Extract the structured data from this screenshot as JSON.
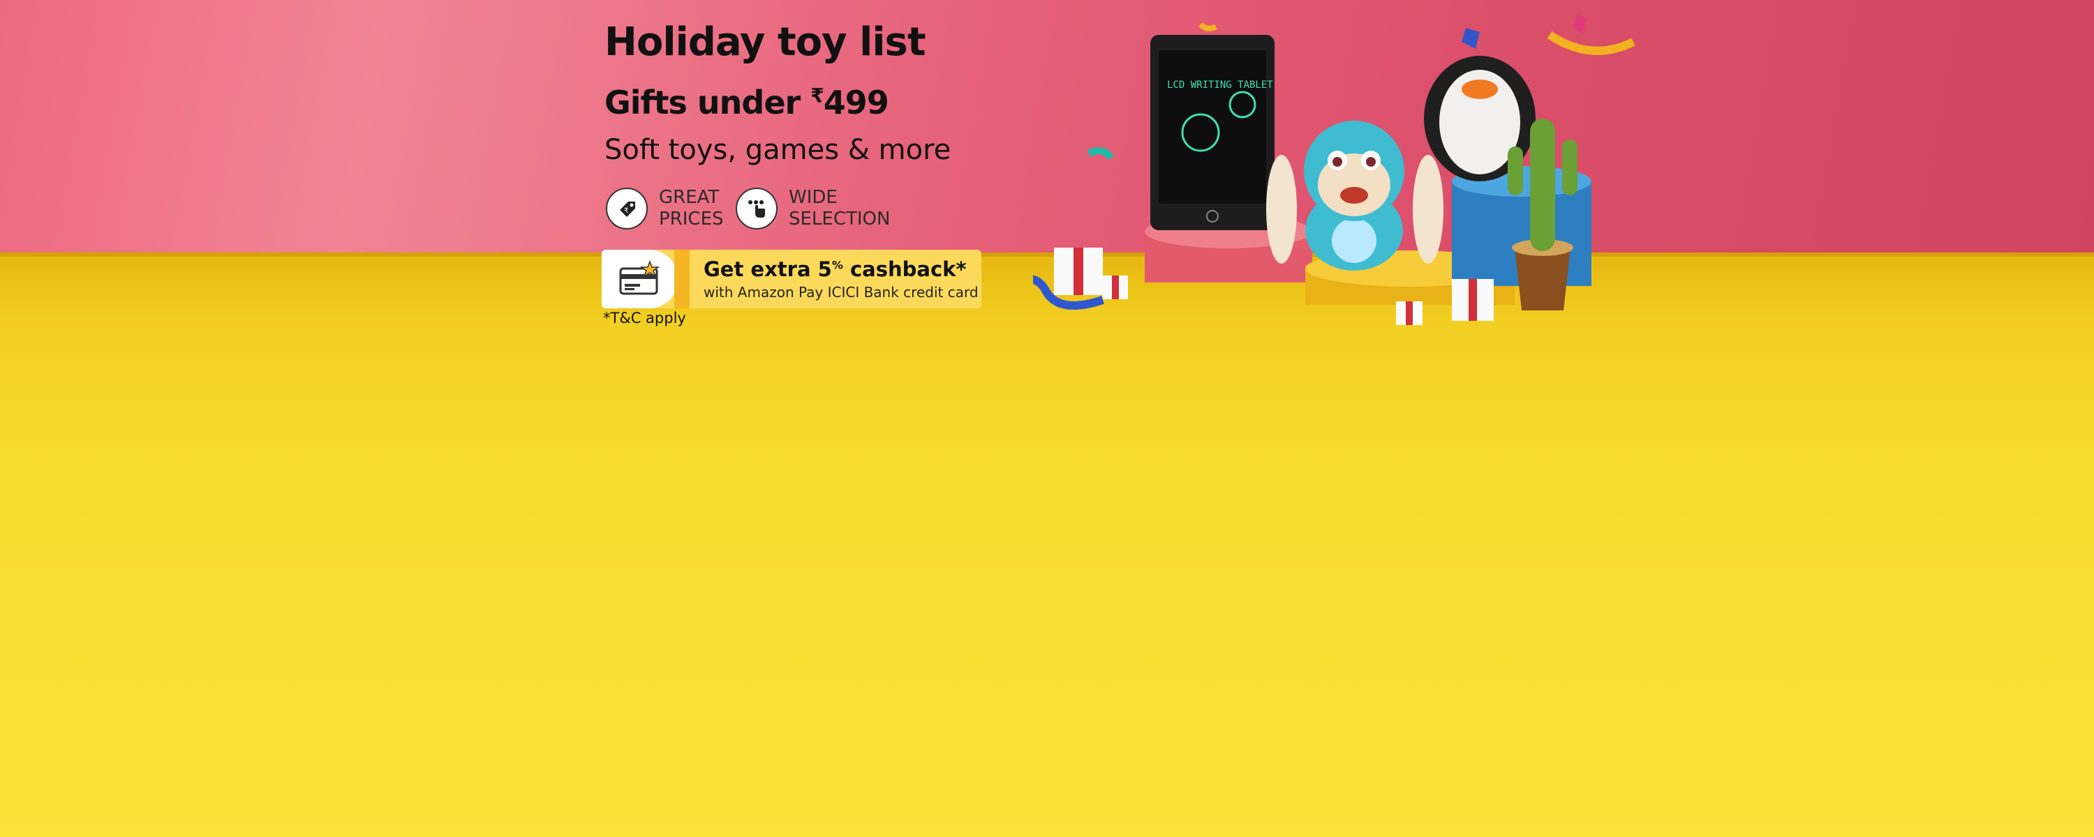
{
  "banner": {
    "title": "Holiday toy list",
    "subtitle_prefix": "Gifts under ",
    "currency_symbol": "₹",
    "price": "499",
    "tagline": "Soft toys, games & more"
  },
  "features": [
    {
      "icon": "price-tag-icon",
      "line1": "GREAT",
      "line2": "PRICES"
    },
    {
      "icon": "pointer-hand-icon",
      "line1": "WIDE",
      "line2": "SELECTION"
    }
  ],
  "offer": {
    "icon": "credit-card-star-icon",
    "headline_prefix": "Get extra 5",
    "headline_sup": "%",
    "headline_suffix": " cashback*",
    "subtext": "with Amazon Pay ICICI Bank credit card",
    "terms": "*T&C apply"
  },
  "illustration": {
    "tablet_screen_text": "LCD WRITING TABLET",
    "items": [
      "lcd-writing-tablet",
      "monkey-toy",
      "penguin-plush",
      "dancing-cactus-toy",
      "gift-boxes",
      "confetti"
    ]
  },
  "colors": {
    "top_background": "#e6627a",
    "bottom_background": "#f7da2e",
    "offer_background": "#fdd95b",
    "offer_accent": "#f6b523"
  }
}
